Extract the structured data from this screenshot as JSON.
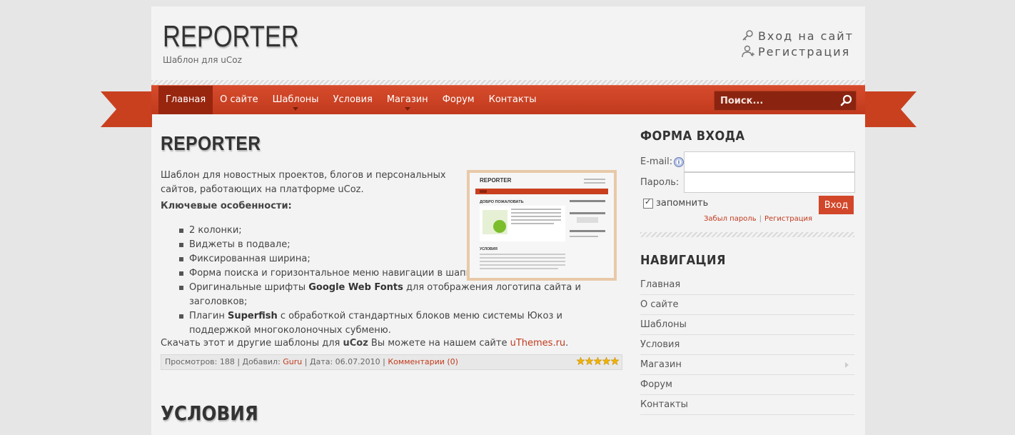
{
  "header": {
    "logo": "REPORTER",
    "slogan": "Шаблон для uCoz",
    "login_link": "Вход на сайт",
    "register_link": "Регистрация"
  },
  "nav": {
    "items": [
      {
        "label": "Главная",
        "active": true,
        "submenu": false
      },
      {
        "label": "О сайте",
        "active": false,
        "submenu": false
      },
      {
        "label": "Шаблоны",
        "active": false,
        "submenu": true
      },
      {
        "label": "Условия",
        "active": false,
        "submenu": false
      },
      {
        "label": "Магазин",
        "active": false,
        "submenu": true
      },
      {
        "label": "Форум",
        "active": false,
        "submenu": false
      },
      {
        "label": "Контакты",
        "active": false,
        "submenu": false
      }
    ],
    "search_placeholder": "Поиск..."
  },
  "post": {
    "title": "REPORTER",
    "intro": "Шаблон для новостных проектов, блогов и персональных сайтов, работающих на платформе uCoz.",
    "key_heading": "Ключевые особенности:",
    "features": [
      {
        "pre": "2 колонки;",
        "bold": "",
        "post": ""
      },
      {
        "pre": "Виджеты в подвале;",
        "bold": "",
        "post": ""
      },
      {
        "pre": "Фиксированная ширина;",
        "bold": "",
        "post": ""
      },
      {
        "pre": "Форма поиска и горизонтальное меню навигации в шапке;",
        "bold": "",
        "post": ""
      },
      {
        "pre": "Оригинальные шрифты ",
        "bold": "Google Web Fonts",
        "post": " для отображения логотипа сайта и заголовков;"
      },
      {
        "pre": "Плагин ",
        "bold": "Superfish",
        "post": " с обработкой стандартных блоков меню системы Юкоз и поддержкой многоколоночных субменю."
      }
    ],
    "download_pre": "Скачать этот и другие шаблоны для ",
    "download_bold": "uCoz",
    "download_mid": " Вы можете на нашем сайте ",
    "download_link": "uThemes.ru",
    "download_end": ".",
    "meta_views": "Просмотров: 188 | Добавил: ",
    "meta_author": "Guru",
    "meta_date": " | Дата: 06.07.2010 | ",
    "meta_comments": "Комментарии (0)",
    "rating": 5
  },
  "thumb": {
    "logo": "REPORTER",
    "welcome": "ДОБРО ПОЖАЛОВАТЬ",
    "section": "УСЛОВИЯ"
  },
  "second_post": {
    "title": "УСЛОВИЯ"
  },
  "sidebar": {
    "login_title": "ФОРМА ВХОДА",
    "email_label": "E-mail:",
    "password_label": "Пароль:",
    "remember_label": "запомнить",
    "login_button": "Вход",
    "forgot_link": "Забыл пароль",
    "register_link": "Регистрация",
    "nav_title": "НАВИГАЦИЯ",
    "nav_items": [
      {
        "label": "Главная",
        "submenu": false
      },
      {
        "label": "О сайте",
        "submenu": false
      },
      {
        "label": "Шаблоны",
        "submenu": false
      },
      {
        "label": "Условия",
        "submenu": false
      },
      {
        "label": "Магазин",
        "submenu": true
      },
      {
        "label": "Форум",
        "submenu": false
      },
      {
        "label": "Контакты",
        "submenu": false
      }
    ]
  },
  "colors": {
    "accent": "#c13a1d",
    "nav_active": "#98260f",
    "page_bg": "#f3f3f3"
  }
}
